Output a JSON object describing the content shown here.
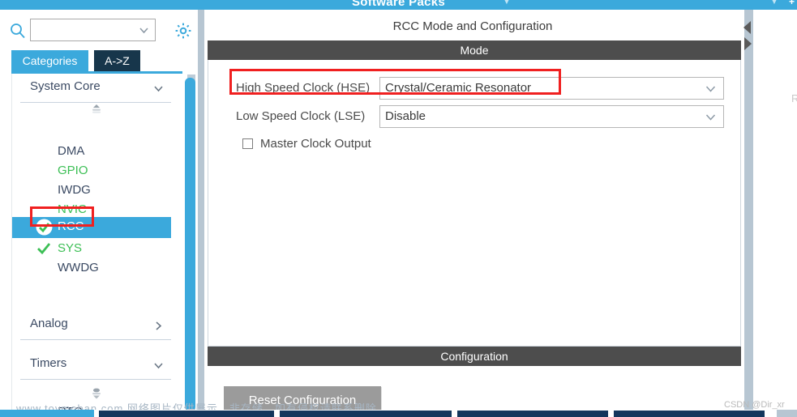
{
  "app": {
    "titlebar_text": "Software Packs",
    "titlebar_plus": "+"
  },
  "sidebar": {
    "search": {
      "icon": "search-icon",
      "value": "",
      "placeholder": "",
      "dropdown_icon": "chevron-down-icon"
    },
    "settings_icon": "gear-icon",
    "tabs": [
      {
        "label": "Categories",
        "selected": true
      },
      {
        "label": "A->Z",
        "selected": false
      }
    ],
    "groups": [
      {
        "label": "System Core",
        "expanded": true,
        "chevron": "chevron-down-icon",
        "items": [
          {
            "label": "DMA",
            "state": "default",
            "checked": false
          },
          {
            "label": "GPIO",
            "state": "green",
            "checked": false
          },
          {
            "label": "IWDG",
            "state": "default",
            "checked": false
          },
          {
            "label": "NVIC",
            "state": "green",
            "checked": false
          },
          {
            "label": "RCC",
            "state": "selected",
            "checked": true
          },
          {
            "label": "SYS",
            "state": "green",
            "checked": true
          },
          {
            "label": "WWDG",
            "state": "default",
            "checked": false
          }
        ]
      },
      {
        "label": "Analog",
        "expanded": false,
        "chevron": "chevron-right-icon",
        "items": []
      },
      {
        "label": "Timers",
        "expanded": true,
        "chevron": "chevron-down-icon",
        "items": [
          {
            "label": "RTC",
            "state": "default",
            "checked": false
          }
        ]
      }
    ],
    "scroll_up_icon": "spinner-up-icon",
    "scroll_down_icon": "spinner-down-icon"
  },
  "main": {
    "panel_title": "RCC Mode and Configuration",
    "mode": {
      "section_label": "Mode",
      "fields": [
        {
          "label": "High Speed Clock (HSE)",
          "value": "Crystal/Ceramic Resonator",
          "dropdown_icon": "chevron-down-icon",
          "highlighted": true
        },
        {
          "label": "Low Speed Clock (LSE)",
          "value": "Disable",
          "dropdown_icon": "chevron-down-icon",
          "highlighted": false
        }
      ],
      "checkbox": {
        "label": "Master Clock Output",
        "checked": false
      }
    },
    "configuration": {
      "section_label": "Configuration",
      "reset_button": "Reset Configuration"
    },
    "collapse_left_icon": "triangle-left-icon",
    "collapse_right_icon": "triangle-right-icon"
  },
  "annotations": [
    {
      "name": "hse-highlight",
      "color": "#f02020"
    },
    {
      "name": "rcc-highlight",
      "color": "#f02020"
    }
  ],
  "watermarks": {
    "left": "www.toymoban.com 网络图片仅供展示，非存储，如有侵权请联系删除。",
    "right": "CSDN @Dir_xr",
    "edge": "R"
  },
  "colors": {
    "accent_blue": "#3ba9dc",
    "tab_dark": "#17364b",
    "section_gray": "#4d4d4d",
    "green": "#3cbf55",
    "annotation_red": "#f02020",
    "splitter": "#b7c6d2"
  }
}
